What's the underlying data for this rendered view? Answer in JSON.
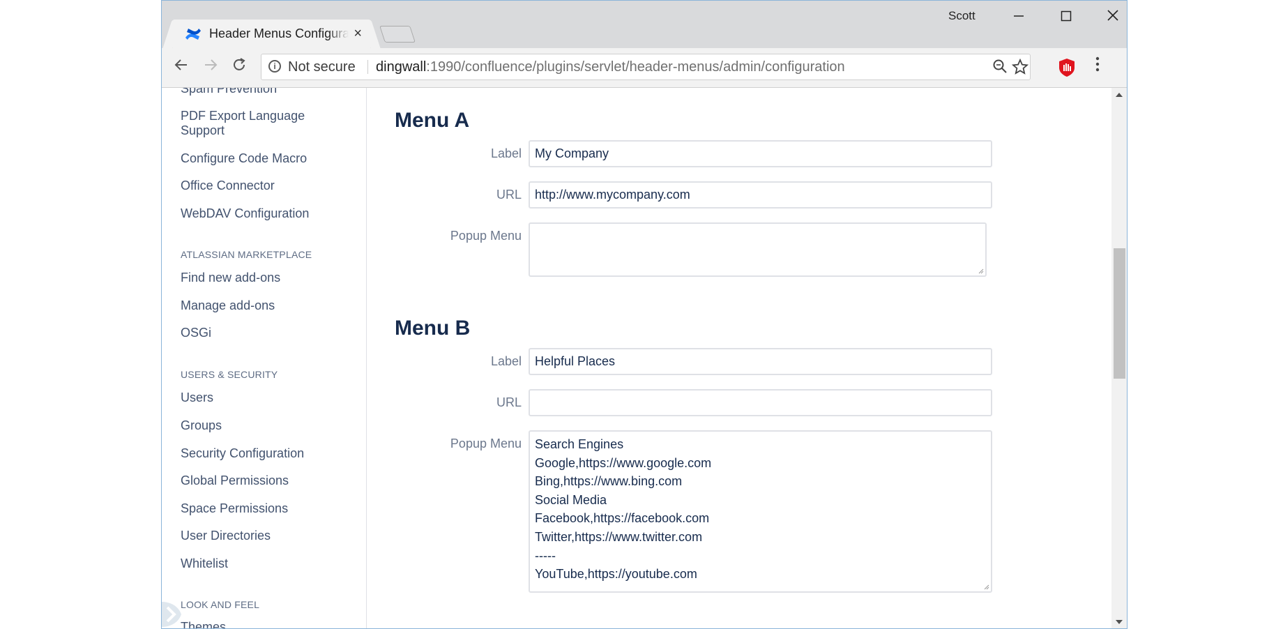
{
  "window": {
    "user": "Scott",
    "tab_title": "Header Menus Configuration",
    "tab_close": "×"
  },
  "toolbar": {
    "security_label": "Not secure",
    "url_host": "dingwall",
    "url_rest": ":1990/confluence/plugins/servlet/header-menus/admin/configuration"
  },
  "sidebar": {
    "top_items": [
      "Spam Prevention",
      "PDF Export Language Support",
      "Configure Code Macro",
      "Office Connector",
      "WebDAV Configuration"
    ],
    "marketplace_heading": "ATLASSIAN MARKETPLACE",
    "marketplace_items": [
      "Find new add-ons",
      "Manage add-ons",
      "OSGi"
    ],
    "users_heading": "USERS & SECURITY",
    "users_items": [
      "Users",
      "Groups",
      "Security Configuration",
      "Global Permissions",
      "Space Permissions",
      "User Directories",
      "Whitelist"
    ],
    "look_heading": "LOOK AND FEEL",
    "look_items": [
      "Themes"
    ]
  },
  "menu_a": {
    "title": "Menu A",
    "label_caption": "Label",
    "label_value": "My Company",
    "url_caption": "URL",
    "url_value": "http://www.mycompany.com",
    "popup_caption": "Popup Menu",
    "popup_lines": []
  },
  "menu_b": {
    "title": "Menu B",
    "label_caption": "Label",
    "label_value": "Helpful Places",
    "url_caption": "URL",
    "url_value": "",
    "popup_caption": "Popup Menu",
    "popup_lines": [
      "Search Engines",
      "Google,https://www.google.com",
      "Bing,https://www.bing.com",
      "Social Media",
      "Facebook,https://facebook.com",
      "Twitter,https://www.twitter.com",
      "-----",
      "YouTube,https://youtube.com"
    ]
  },
  "colors": {
    "heading": "#172b4d",
    "sidebar_link": "#42526e",
    "field_label": "#6b778c",
    "border": "#dfe1e6"
  }
}
